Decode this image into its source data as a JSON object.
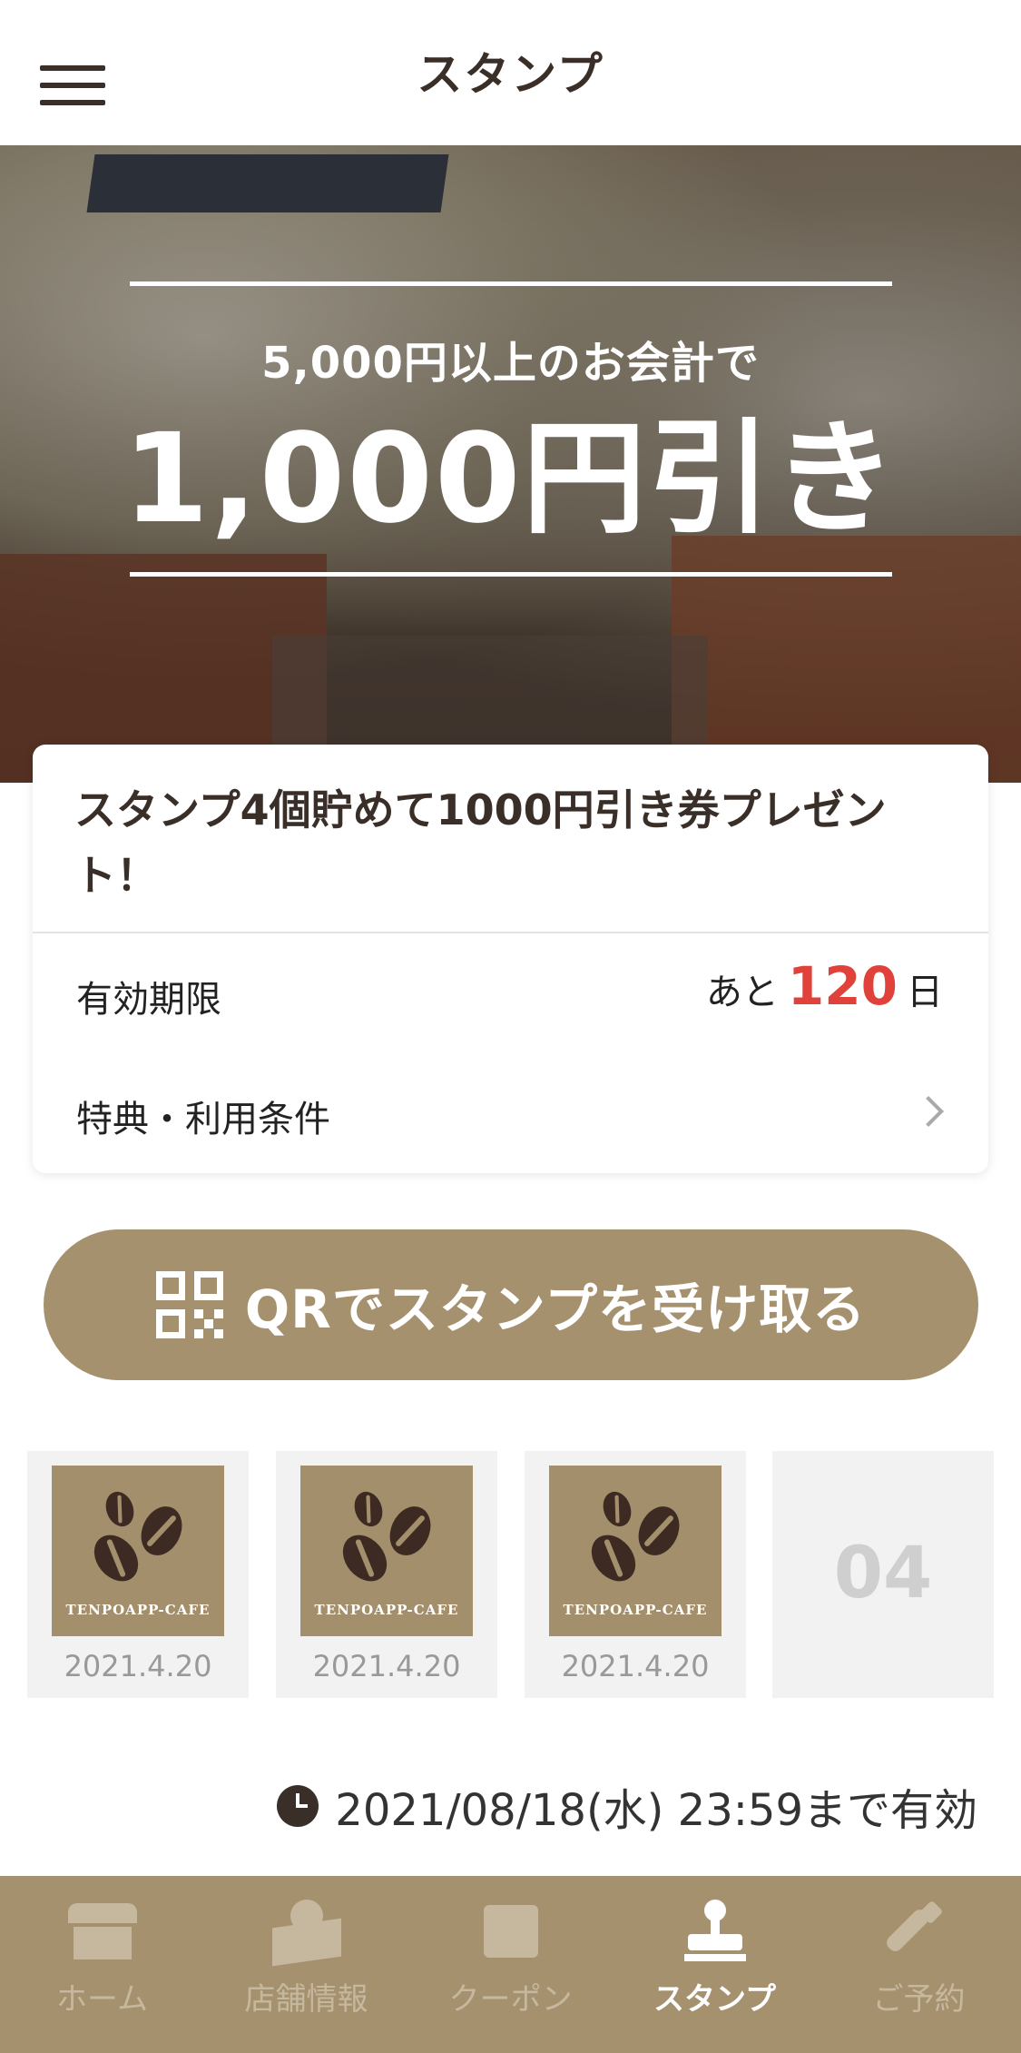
{
  "header": {
    "title": "スタンプ"
  },
  "banner": {
    "subtitle": "5,000円以上のお会計で",
    "headline": "1,000円引き"
  },
  "card": {
    "title": "スタンプ4個貯めて1000円引き券プレゼント！",
    "expiry_label": "有効期限",
    "expiry_prefix": "あと",
    "expiry_days": "120",
    "expiry_suffix": "日",
    "terms_label": "特典・利用条件"
  },
  "qr_button": {
    "label": "QRでスタンプを受け取る"
  },
  "stamps": [
    {
      "brand": "TENPOAPP-CAFE",
      "date": "2021.4.20"
    },
    {
      "brand": "TENPOAPP-CAFE",
      "date": "2021.4.20"
    },
    {
      "brand": "TENPOAPP-CAFE",
      "date": "2021.4.20"
    },
    {
      "number": "04"
    }
  ],
  "validity": {
    "text": "2021/08/18(水) 23:59まで有効"
  },
  "bottom_nav": {
    "items": [
      {
        "label": "ホーム",
        "icon": "shop-icon",
        "active": false
      },
      {
        "label": "店舗情報",
        "icon": "map-pin-icon",
        "active": false
      },
      {
        "label": "クーポン",
        "icon": "coupon-icon",
        "active": false
      },
      {
        "label": "スタンプ",
        "icon": "stamp-icon",
        "active": true
      },
      {
        "label": "ご予約",
        "icon": "phone-icon",
        "active": false
      }
    ]
  },
  "colors": {
    "accent": "#a5916e",
    "highlight_red": "#e0413a",
    "text_dark": "#3a2f28",
    "nav_inactive": "#c6b89e"
  }
}
